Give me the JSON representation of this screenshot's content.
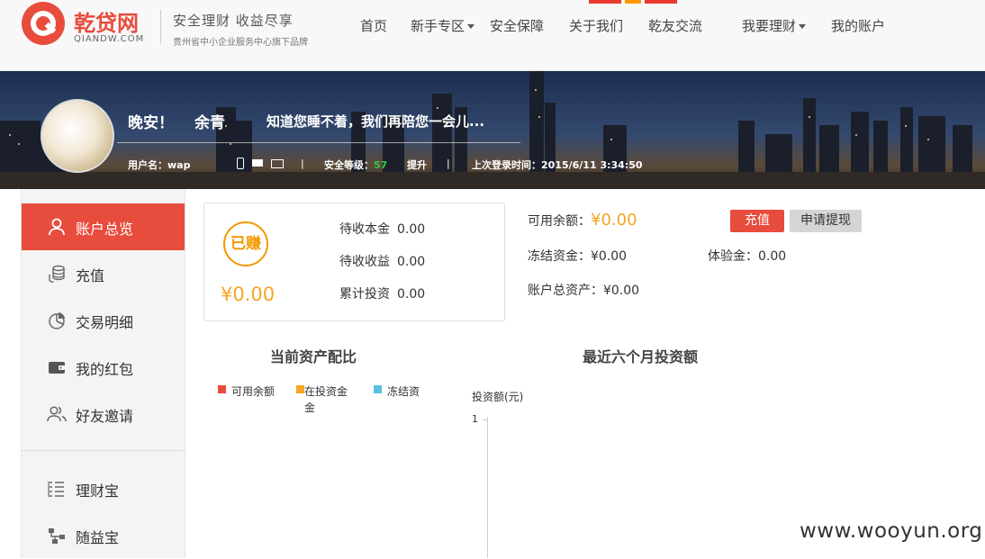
{
  "header": {
    "brand": "乾贷网",
    "domain": "QIANDW.COM",
    "slogan": "安全理财 收益尽享",
    "subslogan": "贵州省中小企业服务中心旗下品牌",
    "nav": [
      {
        "label": "首页"
      },
      {
        "label": "新手专区"
      },
      {
        "label": "安全保障"
      },
      {
        "label": "关于我们"
      },
      {
        "label": "乾友交流"
      },
      {
        "label": "我要理财"
      },
      {
        "label": "我的账户"
      }
    ]
  },
  "banner": {
    "greeting": "晚安！",
    "username": "余青",
    "tagline": "知道您睡不着，我们再陪您一会儿...",
    "account_label": "用户名：wap",
    "separator": "|",
    "security_label": "安全等级：",
    "security_value": "57",
    "upgrade": "提升",
    "last_login": "上次登录时间：2015/6/11 3:34:50"
  },
  "sidebar": {
    "items": [
      {
        "label": "账户总览",
        "icon": "user-icon"
      },
      {
        "label": "充值",
        "icon": "coins-icon"
      },
      {
        "label": "交易明细",
        "icon": "pie-chart-icon"
      },
      {
        "label": "我的红包",
        "icon": "wallet-icon"
      },
      {
        "label": "好友邀请",
        "icon": "friends-icon"
      },
      {
        "label": "理财宝",
        "icon": "list-icon"
      },
      {
        "label": "随益宝",
        "icon": "network-icon"
      }
    ]
  },
  "earn": {
    "badge": "已赚",
    "total": "¥0.00",
    "rows": [
      {
        "label": "待收本金",
        "value": "0.00"
      },
      {
        "label": "待收收益",
        "value": "0.00"
      },
      {
        "label": "累计投资",
        "value": "0.00"
      }
    ]
  },
  "summary": {
    "available_label": "可用余额：",
    "available_value": "¥0.00",
    "frozen_label": "冻结资金：",
    "frozen_value": "¥0.00",
    "trial_label": "体验金：",
    "trial_value": "0.00",
    "total_label": "账户总资产：",
    "total_value": "¥0.00",
    "recharge": "充值",
    "withdraw": "申请提现"
  },
  "charts": {
    "allocation_title": "当前资产配比",
    "legend": [
      {
        "label": "可用余额",
        "color": "#e84c3d"
      },
      {
        "label": "在投资金金",
        "color": "#f5a623"
      },
      {
        "label": "冻结资",
        "color": "#5bc0de"
      }
    ],
    "invest_title": "最近六个月投资额",
    "y_label": "投资额(元)",
    "y_tick": "1"
  },
  "colors": {
    "brand_red": "#e84c3d",
    "orange": "#f5a623",
    "green": "#2ecc40"
  },
  "watermark": "www.wooyun.org"
}
